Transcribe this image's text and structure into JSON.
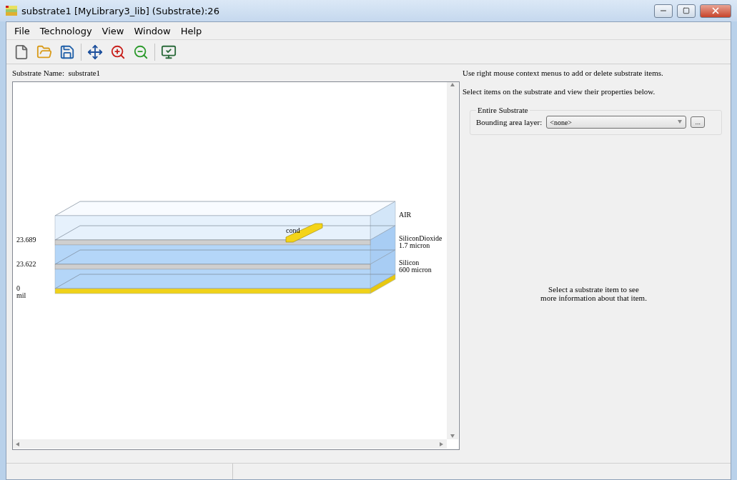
{
  "window": {
    "title": "substrate1 [MyLibrary3_lib] (Substrate):26"
  },
  "menu": [
    "File",
    "Technology",
    "View",
    "Window",
    "Help"
  ],
  "substrate_name": {
    "label": "Substrate Name:",
    "value": "substrate1"
  },
  "diagram": {
    "layers": [
      {
        "kind": "air",
        "lines": [
          "AIR"
        ]
      },
      {
        "kind": "dielectric",
        "lines": [
          "SiliconDioxide",
          "1.7 micron"
        ],
        "left_lines": [
          "23.689"
        ]
      },
      {
        "kind": "dielectric",
        "lines": [
          "Silicon",
          "600 micron"
        ],
        "left_lines": [
          "23.622"
        ]
      },
      {
        "kind": "ground",
        "left_lines": [
          "0",
          "mil"
        ]
      }
    ],
    "conductor": {
      "label": "cond"
    }
  },
  "hints": [
    "Use right mouse context menus to add or delete substrate items.",
    "Select items on the substrate and view their properties below."
  ],
  "entire_substrate": {
    "title": "Entire Substrate",
    "field_label": "Bounding area layer:",
    "value": "<none>",
    "browse": "..."
  },
  "info": [
    "Select a substrate item to see",
    "more information about that item."
  ]
}
